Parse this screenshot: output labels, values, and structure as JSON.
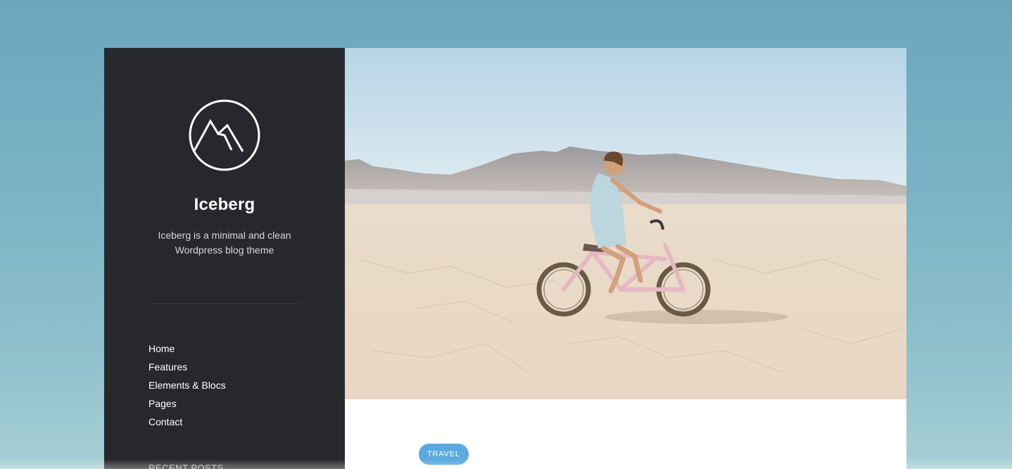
{
  "site": {
    "title": "Iceberg",
    "tagline": "Iceberg is a minimal and clean Wordpress blog theme",
    "logo_icon": "mountain-circle-icon"
  },
  "nav": {
    "items": [
      {
        "label": "Home"
      },
      {
        "label": "Features"
      },
      {
        "label": "Elements & Blocs"
      },
      {
        "label": "Pages"
      },
      {
        "label": "Contact"
      }
    ]
  },
  "widgets": {
    "recent_posts_title": "RECENT POSTS"
  },
  "post": {
    "category": "TRAVEL"
  },
  "colors": {
    "sidebar_bg": "#27282d",
    "accent": "#5aa9e0",
    "page_bg": "#6aa6bd"
  }
}
